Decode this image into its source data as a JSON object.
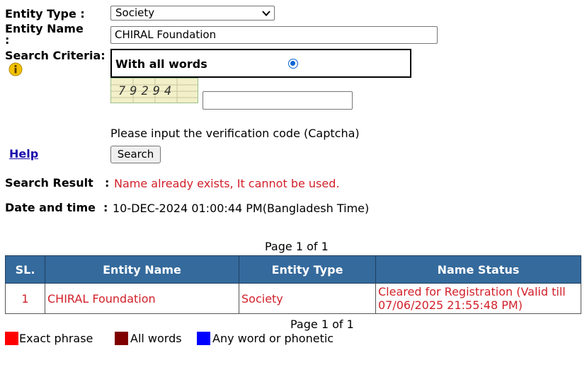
{
  "form": {
    "entity_type_label": "Entity Type :",
    "entity_type_value": "Society",
    "entity_name_label": "Entity Name",
    "entity_name_colon": ":",
    "entity_name_value": "CHIRAL Foundation",
    "search_criteria_label": "Search Criteria:",
    "search_criteria_option": "With all words",
    "captcha_code": "79294",
    "captcha_input_value": "",
    "captcha_instruction": "Please input the verification code (Captcha)",
    "help_link": "Help",
    "search_button": "Search"
  },
  "result": {
    "search_result_label": "Search Result",
    "search_result_colon": ":",
    "search_result_text": "Name already exists, It cannot be used.",
    "datetime_label": "Date and time",
    "datetime_colon": ":",
    "datetime_value": "10-DEC-2024 01:00:44 PM(Bangladesh Time)"
  },
  "table": {
    "page_top": "Page 1 of 1",
    "page_bottom": "Page 1 of 1",
    "headers": [
      "SL.",
      "Entity Name",
      "Entity Type",
      "Name Status"
    ],
    "rows": [
      {
        "sl": "1",
        "entity_name": "CHIRAL Foundation",
        "entity_type": "Society",
        "name_status": "Cleared for Registration (Valid till 07/06/2025 21:55:48 PM)"
      }
    ]
  },
  "legend": [
    {
      "label": "Exact phrase",
      "color": "#ff0000"
    },
    {
      "label": "All words",
      "color": "#800000"
    },
    {
      "label": "Any word or phonetic",
      "color": "#0000ff"
    }
  ],
  "colors": {
    "header_bg": "#356a9c",
    "result_red": "#d2202a",
    "link_blue": "#1a0dab"
  },
  "icons": [
    "info-icon",
    "chevron-down-icon",
    "radio-selected-icon"
  ]
}
